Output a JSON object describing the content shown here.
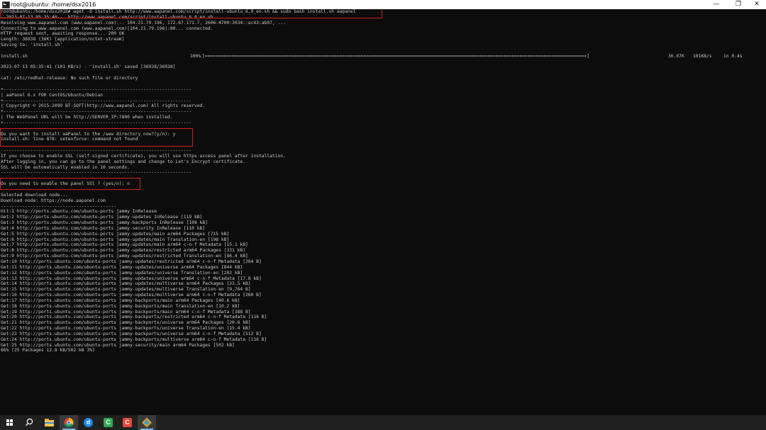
{
  "window": {
    "title": "root@ubuntu: /home/dsx2016",
    "controls": [
      "—",
      "❐",
      "✕"
    ]
  },
  "terminal": {
    "lines": [
      "root@ubuntu:/home/dsx2016# wget -O install.sh http://www.aapanel.com/script/install-ubuntu_6.0_en.sh && sudo bash install.sh aapanel",
      "--2023-07-13 05:35:40--  http://www.aapanel.com/script/install-ubuntu_6.0_en.sh",
      "Resolving www.aapanel.com (www.aapanel.com)... 104.21.79.196, 172.67.171.7, 2606:4700:3034::ac43:ab07, ...",
      "Connecting to www.aapanel.com (www.aapanel.com)|104.21.79.196|:80... connected.",
      "HTTP request sent, awaiting response... 200 OK",
      "Length: 36938 (36K) [application/octet-stream]",
      "Saving to: 'install.sh'",
      "",
      "install.sh",
      "",
      "2023-07-13 05:35:41 (101 KB/s) - 'install.sh' saved [36938/36938]",
      "",
      "cat: /etc/redhat-release: No such file or directory",
      "",
      "+----------------------------------------------------------------------",
      "| aaPanel 6.x FOR CentOS/Ubuntu/Debian",
      "+----------------------------------------------------------------------",
      "| Copyright © 2015-2099 BT-SOFT(http://www.aapanel.com) All rights reserved.",
      "+----------------------------------------------------------------------",
      "| The WebPanel URL will be http://SERVER_IP:7800 when installed.",
      "+----------------------------------------------------------------------",
      "",
      "Do you want to install aaPanel to the /www directory now?(y/n): y",
      "install.sh: line 878: setenforce: command not found",
      "",
      "-----------------------------------------------------------------------",
      "If you choose to enable SSL (self-signed certificate), you will use https access panel after installation.",
      "After logging in, you can go to the panel settings and change to Let's Encrypt certificate.",
      "SSL will be automatically enabled in 10 seconds.",
      "-----------------------------------------------------------------------",
      "",
      "Do you need to enable the panel SSl ? (yes/n): n",
      "-------------------------------------------------",
      "Selected download node...",
      "Download node: https://node.aapanel.com",
      "-------------------------------------------",
      "Hit:1 http://ports.ubuntu.com/ubuntu-ports jammy InRelease",
      "Get:2 http://ports.ubuntu.com/ubuntu-ports jammy-updates InRelease [119 kB]",
      "Get:3 http://ports.ubuntu.com/ubuntu-ports jammy-backports InRelease [108 kB]",
      "Get:4 http://ports.ubuntu.com/ubuntu-ports jammy-security InRelease [110 kB]",
      "Get:5 http://ports.ubuntu.com/ubuntu-ports jammy-updates/main arm64 Packages [715 kB]",
      "Get:6 http://ports.ubuntu.com/ubuntu-ports jammy-updates/main Translation-en [198 kB]",
      "Get:7 http://ports.ubuntu.com/ubuntu-ports jammy-updates/main arm64 c-n-f Metadata [15.1 kB]",
      "Get:8 http://ports.ubuntu.com/ubuntu-ports jammy-updates/restricted arm64 Packages [331 kB]",
      "Get:9 http://ports.ubuntu.com/ubuntu-ports jammy-updates/restricted Translation-en [86.4 kB]",
      "Get:10 http://ports.ubuntu.com/ubuntu-ports jammy-updates/restricted arm64 c-n-f Metadata [384 B]",
      "Get:11 http://ports.ubuntu.com/ubuntu-ports jammy-updates/universe arm64 Packages [844 kB]",
      "Get:12 http://ports.ubuntu.com/ubuntu-ports jammy-updates/universe Translation-en [202 kB]",
      "Get:13 http://ports.ubuntu.com/ubuntu-ports jammy-updates/universe arm64 c-n-f Metadata [17.8 kB]",
      "Get:14 http://ports.ubuntu.com/ubuntu-ports jammy-updates/multiverse arm64 Packages [23.5 kB]",
      "Get:15 http://ports.ubuntu.com/ubuntu-ports jammy-updates/multiverse Translation-en [9,764 B]",
      "Get:16 http://ports.ubuntu.com/ubuntu-ports jammy-updates/multiverse arm64 c-n-f Metadata [260 B]",
      "Get:17 http://ports.ubuntu.com/ubuntu-ports jammy-backports/main arm64 Packages [40.6 kB]",
      "Get:18 http://ports.ubuntu.com/ubuntu-ports jammy-backports/main Translation-en [10.2 kB]",
      "Get:19 http://ports.ubuntu.com/ubuntu-ports jammy-backports/main arm64 c-n-f Metadata [388 B]",
      "Get:20 http://ports.ubuntu.com/ubuntu-ports jammy-backports/restricted arm64 c-n-f Metadata [116 B]",
      "Get:21 http://ports.ubuntu.com/ubuntu-ports jammy-backports/universe arm64 Packages [20.6 kB]",
      "Get:22 http://ports.ubuntu.com/ubuntu-ports jammy-backports/universe Translation-en [15.4 kB]",
      "Get:23 http://ports.ubuntu.com/ubuntu-ports jammy-backports/universe arm64 c-n-f Metadata [512 B]",
      "Get:24 http://ports.ubuntu.com/ubuntu-ports jammy-backports/multiverse arm64 c-n-f Metadata [116 B]",
      "Get:25 http://ports.ubuntu.com/ubuntu-ports jammy-security/main arm64 Packages [502 kB]",
      "66% [25 Packages 12.8 kB/502 kB 3%]"
    ],
    "progress": {
      "percent_label": "100%",
      "bar": "[=============================================================================================================================================>]",
      "size": "36.07K",
      "speed": "101KB/s",
      "eta": "in 0.4s",
      "fraction": 1.0
    },
    "colors": {
      "text": "#c8c8c8",
      "background": "#0c0c0c",
      "highlight": "#d02020"
    }
  },
  "taskbar": {
    "buttons": [
      {
        "name": "start-button",
        "icon": "windows-logo-icon"
      },
      {
        "name": "search-button",
        "icon": "search-icon",
        "glyph": "⚲"
      },
      {
        "name": "file-explorer-button",
        "icon": "folder-icon"
      },
      {
        "name": "chrome-button",
        "icon": "chrome-icon"
      },
      {
        "name": "app-d-button",
        "icon": "app-d-icon",
        "glyph": "d",
        "color": "#1e88e5"
      },
      {
        "name": "app-c-green-button",
        "icon": "app-c-icon",
        "glyph": "C",
        "color": "#34a853"
      },
      {
        "name": "app-c-red-button",
        "icon": "app-c-icon",
        "glyph": "C",
        "color": "#e8483b"
      },
      {
        "name": "terminal-app-button",
        "icon": "app-diamond-icon"
      }
    ]
  }
}
